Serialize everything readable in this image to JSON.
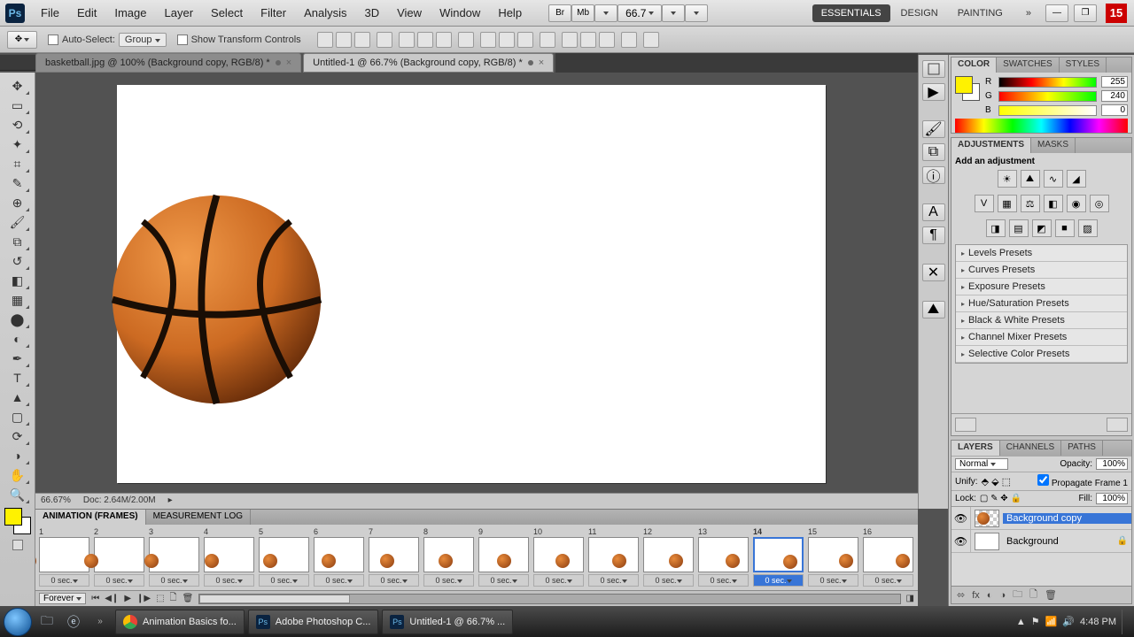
{
  "menubar": {
    "items": [
      "File",
      "Edit",
      "Image",
      "Layer",
      "Select",
      "Filter",
      "Analysis",
      "3D",
      "View",
      "Window",
      "Help"
    ],
    "zoom_display": "66.7",
    "workspaces": [
      "ESSENTIALS",
      "DESIGN",
      "PAINTING"
    ],
    "active_workspace": 0,
    "red_number": "15",
    "icon_labels": [
      "Br",
      "Mb"
    ]
  },
  "options": {
    "auto_select_label": "Auto-Select:",
    "auto_select_mode": "Group",
    "show_tc_label": "Show Transform Controls"
  },
  "doc_tabs": [
    {
      "label": "basketball.jpg @ 100% (Background copy, RGB/8) *",
      "active": false
    },
    {
      "label": "Untitled-1 @ 66.7% (Background copy, RGB/8) *",
      "active": true
    }
  ],
  "status": {
    "zoom": "66.67%",
    "doc": "Doc: 2.64M/2.00M"
  },
  "tools": [
    "move",
    "rect-marquee",
    "lasso",
    "quick-select",
    "crop",
    "eyedropper",
    "heal",
    "brush",
    "stamp",
    "history-brush",
    "eraser",
    "gradient",
    "blur",
    "dodge",
    "pen",
    "type",
    "path-select",
    "rectangle",
    "3d-rotate",
    "3d-orbit",
    "hand",
    "zoom"
  ],
  "color_panel": {
    "tabs": [
      "COLOR",
      "SWATCHES",
      "STYLES"
    ],
    "channels": [
      {
        "ch": "R",
        "val": "255"
      },
      {
        "ch": "G",
        "val": "240"
      },
      {
        "ch": "B",
        "val": "0"
      }
    ]
  },
  "adjustments_panel": {
    "tabs": [
      "ADJUSTMENTS",
      "MASKS"
    ],
    "header_text": "Add an adjustment",
    "presets": [
      "Levels Presets",
      "Curves Presets",
      "Exposure Presets",
      "Hue/Saturation Presets",
      "Black & White Presets",
      "Channel Mixer Presets",
      "Selective Color Presets"
    ]
  },
  "layers_panel": {
    "tabs": [
      "LAYERS",
      "CHANNELS",
      "PATHS"
    ],
    "blend_mode": "Normal",
    "opacity_label": "Opacity:",
    "opacity_val": "100%",
    "unify_label": "Unify:",
    "propagate_label": "Propagate Frame 1",
    "lock_label": "Lock:",
    "fill_label": "Fill:",
    "fill_val": "100%",
    "layers": [
      {
        "name": "Background copy",
        "selected": true,
        "thumb": "ball",
        "locked": false
      },
      {
        "name": "Background",
        "selected": false,
        "thumb": "white",
        "locked": true
      }
    ]
  },
  "animation_panel": {
    "tabs": [
      "ANIMATION (FRAMES)",
      "MEASUREMENT LOG"
    ],
    "loop": "Forever",
    "selected_frame": 14,
    "frames": [
      {
        "n": "1",
        "delay": "0 sec.",
        "bx": -20
      },
      {
        "n": "2",
        "delay": "0 sec.",
        "bx": -12
      },
      {
        "n": "3",
        "delay": "0 sec.",
        "bx": -6
      },
      {
        "n": "4",
        "delay": "0 sec.",
        "bx": 0
      },
      {
        "n": "5",
        "delay": "0 sec.",
        "bx": 4
      },
      {
        "n": "6",
        "delay": "0 sec.",
        "bx": 8
      },
      {
        "n": "7",
        "delay": "0 sec.",
        "bx": 12
      },
      {
        "n": "8",
        "delay": "0 sec.",
        "bx": 16
      },
      {
        "n": "9",
        "delay": "0 sec.",
        "bx": 20
      },
      {
        "n": "10",
        "delay": "0 sec.",
        "bx": 24
      },
      {
        "n": "11",
        "delay": "0 sec.",
        "bx": 26
      },
      {
        "n": "12",
        "delay": "0 sec.",
        "bx": 28
      },
      {
        "n": "13",
        "delay": "0 sec.",
        "bx": 30
      },
      {
        "n": "14",
        "delay": "0 sec.",
        "bx": 32
      },
      {
        "n": "15",
        "delay": "0 sec.",
        "bx": 34
      },
      {
        "n": "16",
        "delay": "0 sec.",
        "bx": 36
      }
    ]
  },
  "taskbar": {
    "items": [
      {
        "label": "Animation Basics fo...",
        "icon": "chrome"
      },
      {
        "label": "Adobe Photoshop C...",
        "icon": "ps"
      },
      {
        "label": "Untitled-1 @ 66.7% ...",
        "icon": "ps"
      }
    ],
    "tray_time": "4:48 PM"
  }
}
